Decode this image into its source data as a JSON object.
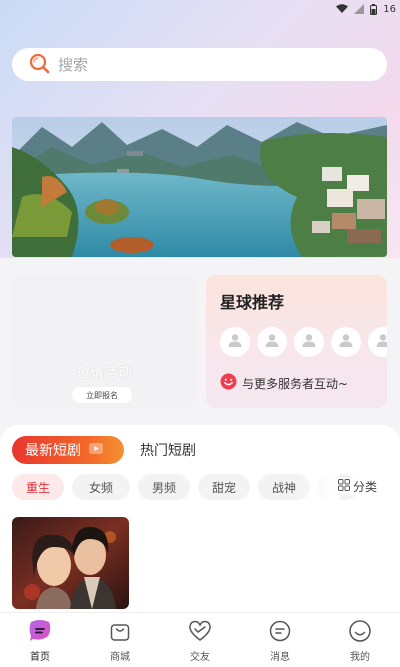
{
  "status_bar": {
    "battery_text": "16"
  },
  "search": {
    "placeholder": "搜索"
  },
  "promo": {
    "ghost_text": "邀请活动",
    "button_label": "立即报名"
  },
  "planet": {
    "title": "星球推荐",
    "interact_text": "与更多服务者互动~",
    "avatar_count": 5
  },
  "tabs": {
    "latest_label": "最新短剧",
    "hot_label": "热门短剧"
  },
  "chips": [
    {
      "label": "重生",
      "active": true
    },
    {
      "label": "女频",
      "active": false
    },
    {
      "label": "男频",
      "active": false
    },
    {
      "label": "甜宠",
      "active": false
    },
    {
      "label": "战神",
      "active": false
    },
    {
      "label": "热",
      "active": false
    }
  ],
  "category_label": "分类",
  "bottom_nav": [
    {
      "label": "首页",
      "icon": "home-chat-icon",
      "active": true
    },
    {
      "label": "商城",
      "icon": "shop-bag-icon",
      "active": false
    },
    {
      "label": "交友",
      "icon": "heart-icon",
      "active": false
    },
    {
      "label": "消息",
      "icon": "message-icon",
      "active": false
    },
    {
      "label": "我的",
      "icon": "profile-smile-icon",
      "active": false
    }
  ],
  "colors": {
    "accent_red": "#e3313b",
    "tab_gradient_start": "#e8352c",
    "tab_gradient_end": "#f49132",
    "chip_active_bg": "#fde8ea"
  }
}
